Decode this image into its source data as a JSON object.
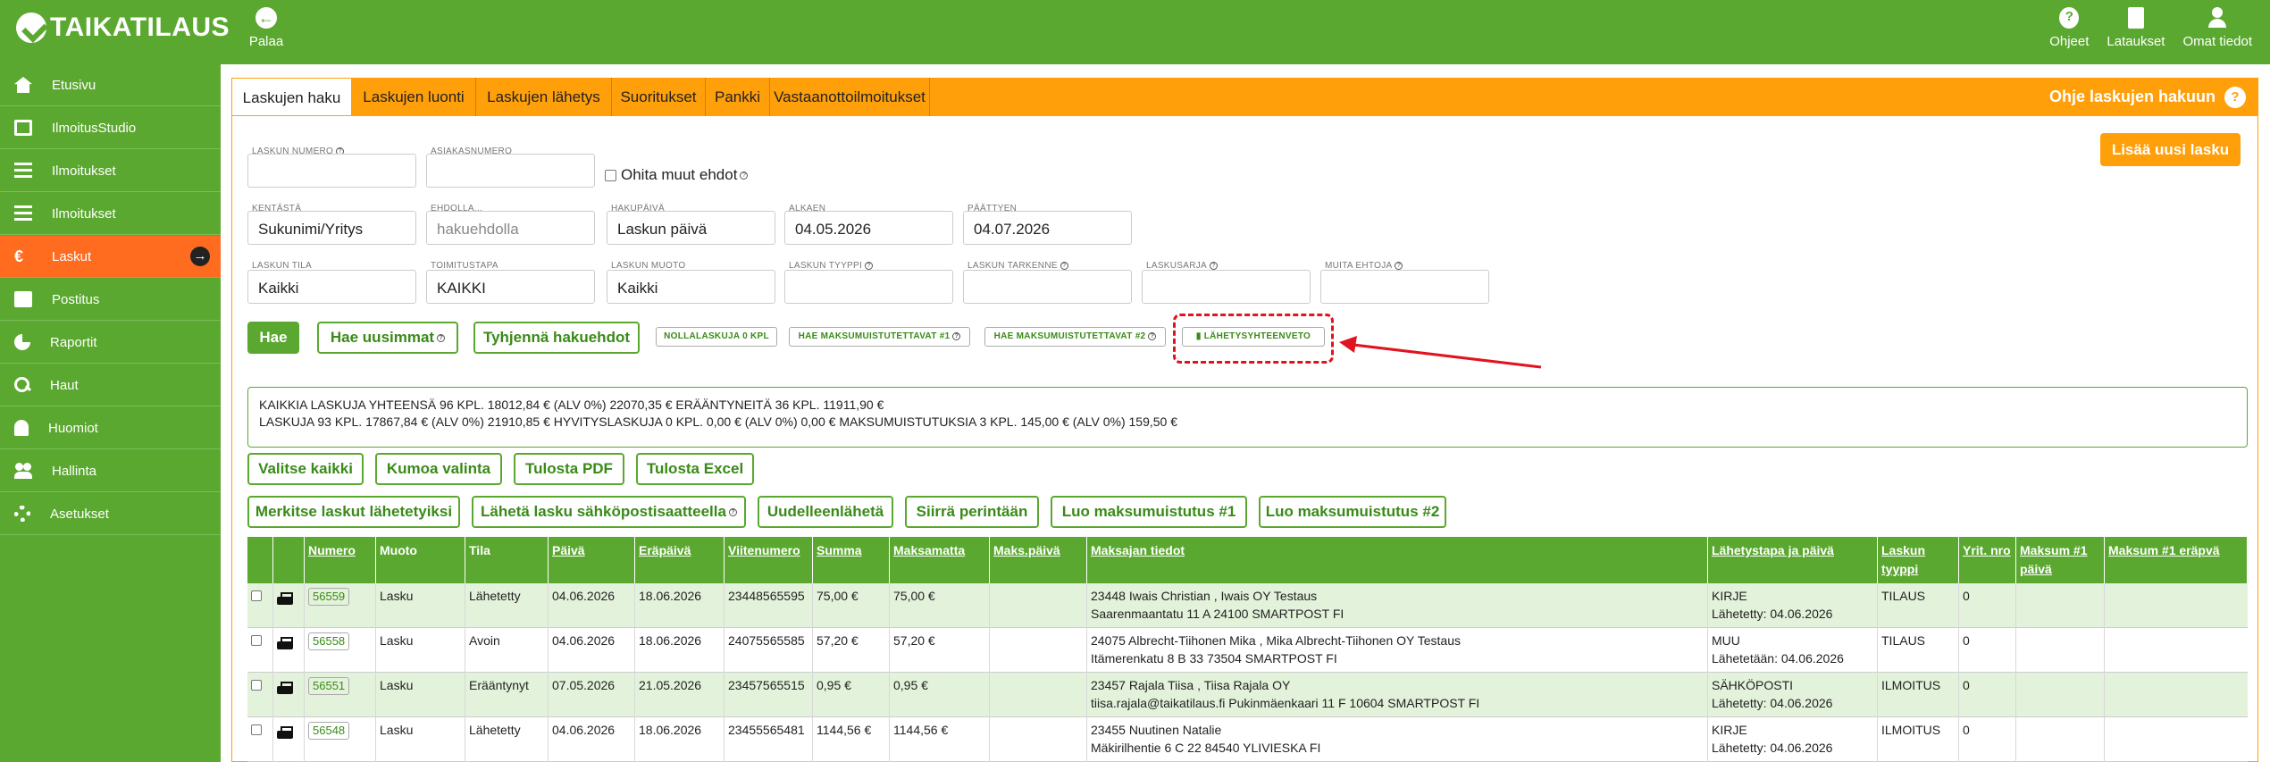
{
  "app": {
    "logo": "TAIKATILAUS",
    "back_label": "Palaa"
  },
  "top_nav": [
    {
      "label": "Ohjeet",
      "icon": "help-icon"
    },
    {
      "label": "Lataukset",
      "icon": "document-icon"
    },
    {
      "label": "Omat tiedot",
      "icon": "user-icon"
    }
  ],
  "sidebar": {
    "items": [
      {
        "label": "Etusivu",
        "icon": "home-icon"
      },
      {
        "label": "IlmoitusStudio",
        "icon": "card-icon"
      },
      {
        "label": "Ilmoitukset",
        "icon": "list-icon"
      },
      {
        "label": "Ilmoitukset",
        "icon": "list-icon"
      },
      {
        "label": "Laskut",
        "icon": "euro-icon",
        "active": true
      },
      {
        "label": "Postitus",
        "icon": "mail-icon"
      },
      {
        "label": "Raportit",
        "icon": "pie-chart-icon"
      },
      {
        "label": "Haut",
        "icon": "search-icon"
      },
      {
        "label": "Huomiot",
        "icon": "bell-icon"
      },
      {
        "label": "Hallinta",
        "icon": "users-icon"
      },
      {
        "label": "Asetukset",
        "icon": "gear-icon"
      }
    ]
  },
  "tabs": [
    {
      "label": "Laskujen haku",
      "active": true
    },
    {
      "label": "Laskujen luonti"
    },
    {
      "label": "Laskujen lähetys"
    },
    {
      "label": "Suoritukset"
    },
    {
      "label": "Pankki"
    },
    {
      "label": "Vastaanottoilmoitukset"
    }
  ],
  "help_link": "Ohje laskujen hakuun",
  "add_invoice_button": "Lisää uusi lasku",
  "form": {
    "invoice_number": {
      "label": "LASKUN NUMERO",
      "value": ""
    },
    "customer_number": {
      "label": "ASIAKASNUMERO",
      "value": ""
    },
    "ignore_other": {
      "label": "Ohita muut ehdot"
    },
    "field": {
      "label": "KENTÄSTÄ",
      "value": "Sukunimi/Yritys"
    },
    "condition": {
      "label": "EHDOLLA...",
      "placeholder": "hakuehdolla"
    },
    "search_date": {
      "label": "HAKUPÄIVÄ",
      "value": "Laskun päivä"
    },
    "start": {
      "label": "ALKAEN",
      "value": "04.05.2026"
    },
    "end": {
      "label": "PÄÄTTYEN",
      "value": "04.07.2026"
    },
    "invoice_status": {
      "label": "LASKUN TILA",
      "value": "Kaikki"
    },
    "delivery_method": {
      "label": "TOIMITUSTAPA",
      "value": "KAIKKI"
    },
    "invoice_form": {
      "label": "LASKUN MUOTO",
      "value": "Kaikki"
    },
    "invoice_type": {
      "label": "LASKUN TYYPPI",
      "value": ""
    },
    "invoice_detail": {
      "label": "LASKUN TARKENNE",
      "value": ""
    },
    "invoice_series": {
      "label": "LASKUSARJA",
      "value": ""
    },
    "other_conditions": {
      "label": "MUITA EHTOJA",
      "value": ""
    }
  },
  "search_buttons": {
    "search": "Hae",
    "latest": "Hae uusimmat",
    "clear": "Tyhjennä hakuehdot",
    "zero_invoices": "NOLLALASKUJA 0 KPL",
    "reminder1": "HAE MAKSUMUISTUTETTAVAT #1",
    "reminder2": "HAE MAKSUMUISTUTETTAVAT #2",
    "summary": "LÄHETYSYHTEENVETO"
  },
  "summary": {
    "line1": "KAIKKIA LASKUJA YHTEENSÄ 96 KPL. 18012,84 € (ALV 0%)  22070,35 € ERÄÄNTYNEITÄ 36 KPL. 11911,90 €",
    "line2": "LASKUJA 93 KPL. 17867,84 € (ALV 0%)  21910,85 €   HYVITYSLASKUJA 0 KPL. 0,00 € (ALV 0%)  0,00 €   MAKSUMUISTUTUKSIA 3 KPL. 145,00 € (ALV 0%)  159,50 €"
  },
  "action_buttons_row1": [
    "Valitse kaikki",
    "Kumoa valinta",
    "Tulosta PDF",
    "Tulosta Excel"
  ],
  "action_buttons_row2": [
    "Merkitse laskut lähetetyiksi",
    "Lähetä lasku sähköpostisaatteella",
    "Uudelleenlähetä",
    "Siirrä perintään",
    "Luo maksumuistutus #1",
    "Luo maksumuistutus #2"
  ],
  "table": {
    "headers": [
      "",
      "",
      "Numero",
      "Muoto",
      "Tila",
      "Päivä",
      "Eräpäivä",
      "Viitenumero",
      "Summa",
      "Maksamatta",
      "Maks.päivä",
      "Maksajan tiedot",
      "Lähetystapa ja päivä",
      "Laskun tyyppi",
      "Yrit. nro",
      "Maksum #1 päivä",
      "Maksum #1 eräpvä"
    ],
    "rows": [
      {
        "number": "56559",
        "form": "Lasku",
        "status": "Lähetetty",
        "date": "04.06.2026",
        "due": "18.06.2026",
        "ref": "23448565595",
        "sum": "75,00 €",
        "unpaid": "75,00 €",
        "paid_date": "",
        "payer1": "23448 Iwais Christian , Iwais OY Testaus",
        "payer2": "Saarenmaantatu 11 A 24100 SMARTPOST FI",
        "send1": "KIRJE",
        "send2": "Lähetetty: 04.06.2026",
        "type": "TILAUS",
        "company": "0"
      },
      {
        "number": "56558",
        "form": "Lasku",
        "status": "Avoin",
        "date": "04.06.2026",
        "due": "18.06.2026",
        "ref": "24075565585",
        "sum": "57,20 €",
        "unpaid": "57,20 €",
        "paid_date": "",
        "payer1": "24075 Albrecht-Tiihonen Mika , Mika Albrecht-Tiihonen OY Testaus",
        "payer2": "Itämerenkatu 8 B 33 73504 SMARTPOST FI",
        "send1": "MUU",
        "send2": "Lähetetään: 04.06.2026",
        "type": "TILAUS",
        "company": "0"
      },
      {
        "number": "56551",
        "form": "Lasku",
        "status": "Erääntynyt",
        "date": "07.05.2026",
        "due": "21.05.2026",
        "ref": "23457565515",
        "sum": "0,95 €",
        "unpaid": "0,95 €",
        "paid_date": "",
        "payer1": "23457 Rajala Tiisa , Tiisa Rajala OY",
        "payer2": "tiisa.rajala@taikatilaus.fi Pukinmäenkaari 11 F 10604 SMARTPOST FI",
        "send1": "SÄHKÖPOSTI",
        "send2": "Lähetetty: 04.06.2026",
        "type": "ILMOITUS",
        "company": "0"
      },
      {
        "number": "56548",
        "form": "Lasku",
        "status": "Lähetetty",
        "date": "04.06.2026",
        "due": "18.06.2026",
        "ref": "23455565481",
        "sum": "1144,56 €",
        "unpaid": "1144,56 €",
        "paid_date": "",
        "payer1": "23455 Nuutinen Natalie",
        "payer2": "Mäkirilhentie 6 C 22 84540 YLIVIESKA FI",
        "send1": "KIRJE",
        "send2": "Lähetetty: 04.06.2026",
        "type": "ILMOITUS",
        "company": "0"
      }
    ]
  },
  "colors": {
    "brand_green": "#5ba830",
    "accent_orange": "#ff9f0a",
    "active_orange": "#ff6b1f",
    "arrow_red": "#e0141e"
  }
}
